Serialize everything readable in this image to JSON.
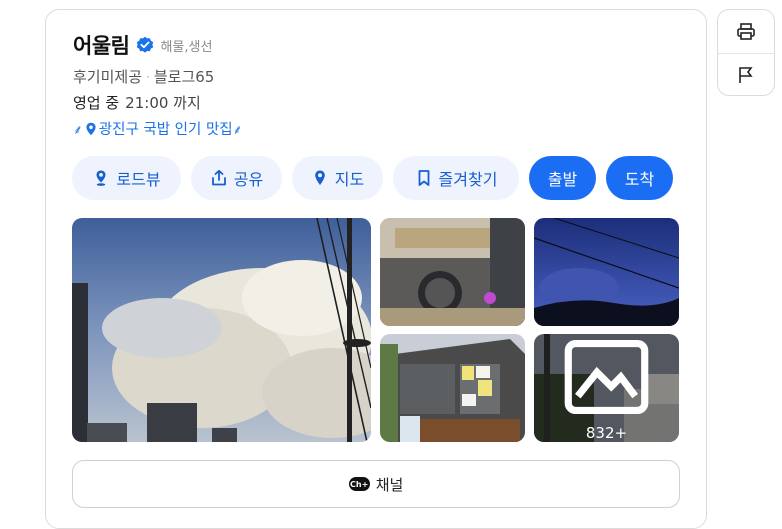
{
  "place": {
    "name": "어울림",
    "category": "해물,생선",
    "reviews": "후기미제공",
    "blog": "블로그65",
    "status": "영업 중",
    "hours": "21:00 까지",
    "tag_left": "⸙",
    "tag_text": "광진구 국밥 인기 맛집",
    "tag_right": "⸙"
  },
  "actions": {
    "roadview": "로드뷰",
    "share": "공유",
    "map": "지도",
    "favorite": "즐겨찾기",
    "departure": "출발",
    "arrival": "도착"
  },
  "photos": {
    "more_count": "832+"
  },
  "channel": {
    "badge": "Ch+",
    "label": "채널"
  },
  "colors": {
    "accent": "#1b6ef3",
    "pill_bg": "#eef3fd",
    "pill_text": "#1a5fd0",
    "verified": "#1a73e8"
  },
  "icons": [
    "print-icon",
    "flag-icon",
    "verified-badge-icon",
    "location-pin-icon",
    "roadview-icon",
    "share-icon",
    "map-pin-icon",
    "bookmark-icon",
    "image-icon",
    "channel-icon"
  ]
}
